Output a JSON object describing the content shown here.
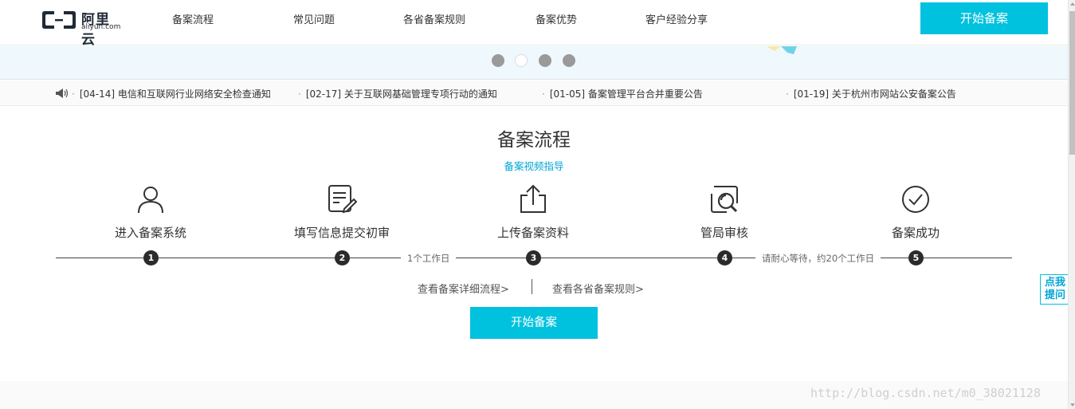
{
  "header": {
    "logo_cn": "阿里云",
    "logo_en": "aliyun.com",
    "nav": [
      "备案流程",
      "常见问题",
      "各省备案规则",
      "备案优势",
      "客户经验分享"
    ],
    "start_button": "开始备案"
  },
  "banner": {
    "dots": 4,
    "active_dot": 2
  },
  "notices": [
    {
      "date": "[04-14]",
      "text": "电信和互联网行业网络安全检查通知"
    },
    {
      "date": "[02-17]",
      "text": "关于互联网基础管理专项行动的通知"
    },
    {
      "date": "[01-05]",
      "text": "备案管理平台合并重要公告"
    },
    {
      "date": "[01-19]",
      "text": "关于杭州市网站公安备案公告"
    }
  ],
  "process": {
    "title": "备案流程",
    "video_link": "备案视频指导",
    "steps": [
      {
        "num": "1",
        "label": "进入备案系统",
        "icon": "user-icon"
      },
      {
        "num": "2",
        "label": "填写信息提交初审",
        "icon": "form-edit-icon"
      },
      {
        "num": "3",
        "label": "上传备案资料",
        "icon": "upload-icon"
      },
      {
        "num": "4",
        "label": "管局审核",
        "icon": "review-search-icon"
      },
      {
        "num": "5",
        "label": "备案成功",
        "icon": "check-circle-icon"
      }
    ],
    "note_2_3": "1个工作日",
    "note_4_5": "请耐心等待，约20个工作日",
    "link_detail": "查看备案详细流程>",
    "link_rules": "查看各省备案规则>",
    "start_button": "开始备案"
  },
  "feedback": {
    "line1": "点我",
    "line2": "提问"
  },
  "watermark": "http://blog.csdn.net/m0_38021128",
  "colors": {
    "accent": "#00c1de",
    "link": "#00a5d8",
    "step_num_bg": "#2b2b2b"
  }
}
